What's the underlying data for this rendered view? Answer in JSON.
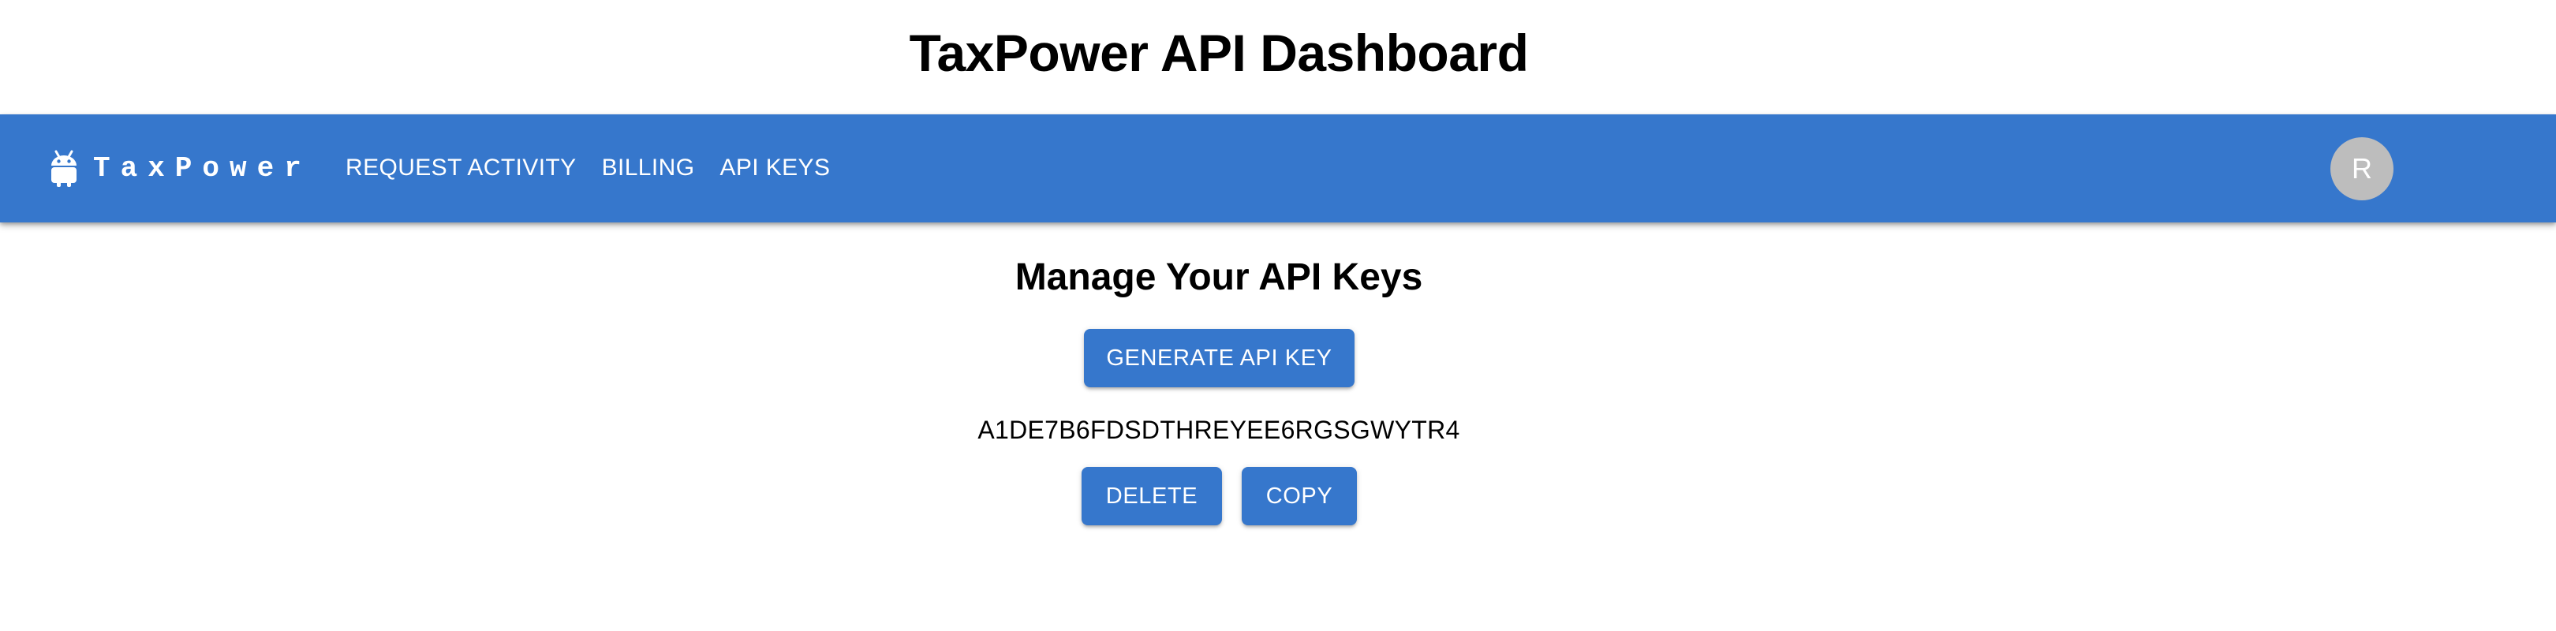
{
  "page": {
    "title": "TaxPower API Dashboard"
  },
  "navbar": {
    "brand_name": "TaxPower",
    "logo_icon": "android-icon",
    "items": [
      {
        "label": "REQUEST ACTIVITY"
      },
      {
        "label": "BILLING"
      },
      {
        "label": "API KEYS"
      }
    ],
    "avatar_initial": "R",
    "colors": {
      "background": "#3677cc",
      "avatar": "#bdbdbd"
    }
  },
  "main": {
    "heading": "Manage Your API Keys",
    "generate_label": "GENERATE API KEY",
    "api_key": "A1DE7B6FDSDTHREYEE6RGSGWYTR4",
    "delete_label": "DELETE",
    "copy_label": "COPY",
    "accent_color": "#3677cc"
  }
}
